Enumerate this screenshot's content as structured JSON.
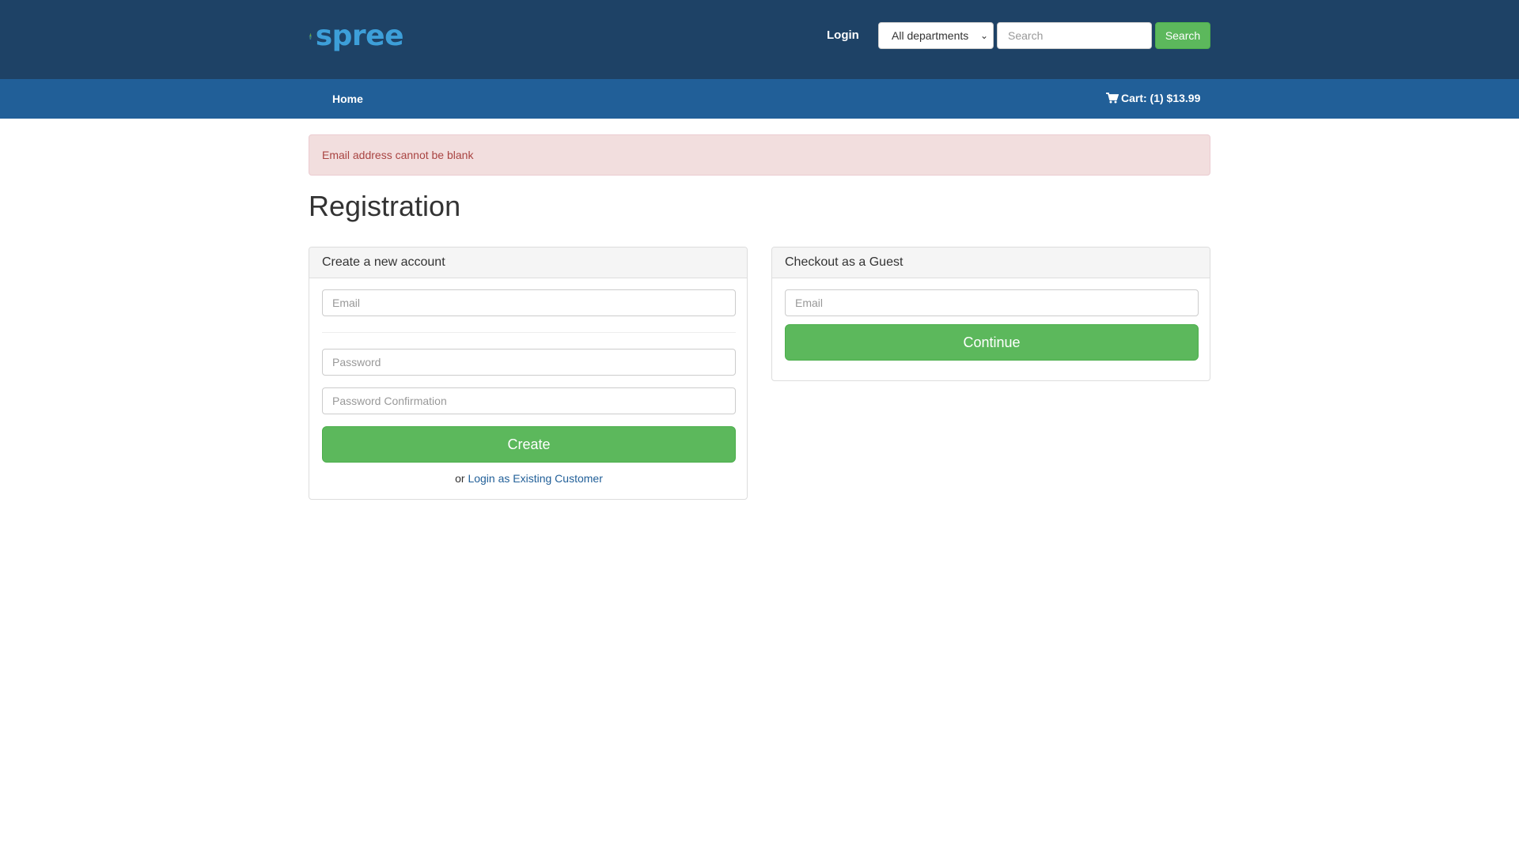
{
  "header": {
    "logo_text": "spree",
    "login_label": "Login",
    "department_select": "All departments",
    "search_placeholder": "Search",
    "search_button": "Search"
  },
  "nav": {
    "home_label": "Home",
    "cart_label": "Cart: (1) $13.99"
  },
  "alert": {
    "message": "Email address cannot be blank"
  },
  "page": {
    "title": "Registration"
  },
  "new_account": {
    "heading": "Create a new account",
    "email_placeholder": "Email",
    "password_placeholder": "Password",
    "password_confirmation_placeholder": "Password Confirmation",
    "create_button": "Create",
    "or_text": "or",
    "login_existing_link": "Login as Existing Customer"
  },
  "guest": {
    "heading": "Checkout as a Guest",
    "email_placeholder": "Email",
    "continue_button": "Continue"
  },
  "colors": {
    "header_bg": "#1e4266",
    "nav_bg": "#215f98",
    "button_green": "#5cb85c",
    "alert_bg": "#f2dede",
    "alert_text": "#a94442",
    "logo_blue": "#3d9fd9",
    "logo_green": "#7ac143"
  }
}
